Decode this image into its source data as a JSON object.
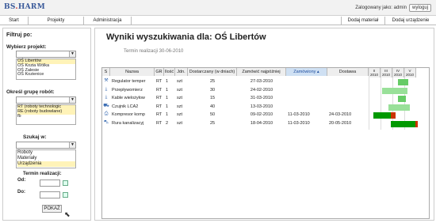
{
  "app": {
    "logo_main": "BS",
    "logo_dot": ".",
    "logo_rest": "HARM",
    "user_label": "Zalogowany jako: admin",
    "logout": "wyloguj"
  },
  "nav": {
    "items": [
      "Start",
      "Projekty",
      "Administracja"
    ],
    "right": [
      "Dodaj materiał",
      "Dodaj urządzenie"
    ]
  },
  "filters": {
    "heading": "Filtruj po:",
    "project_label": "Wybierz projekt:",
    "projects": [
      "OŚ Libertów",
      "OŚ Kozia Wólka",
      "OŚ Zalesie",
      "OŚ Kozienice"
    ],
    "robot_label": "Określ grupę robót:",
    "robot_groups": [
      "RT (roboty technologic",
      "RE (roboty budowlane)",
      "fb"
    ],
    "search_label": "Szukaj w:",
    "search_in": [
      "Roboty",
      "Materiały",
      "Urządzenia"
    ],
    "term_label": "Termin realizacji:",
    "from_label": "Od:",
    "to_label": "Do:",
    "show_button": "POKAŻ"
  },
  "main": {
    "title": "Wyniki wyszukiwania dla: OŚ Libertów",
    "subtitle": "Termin realizacji 30-06-2010",
    "columns": [
      "S",
      "Nazwa",
      "GR",
      "Ilość",
      "Jdn.",
      "Dostarczany (w dniach)",
      "Zamówić najpóźniej",
      "Zamówiony",
      "Dostawa"
    ],
    "gantt_headers": [
      {
        "mon": "II",
        "year": "2010"
      },
      {
        "mon": "III",
        "year": "2010"
      },
      {
        "mon": "IV",
        "year": "2010"
      },
      {
        "mon": "V",
        "year": "2010"
      }
    ],
    "rows": [
      {
        "icon": "wrench-icon",
        "glyph": "⚒",
        "name": "Regulator temper",
        "gr": "RT",
        "qty": "1",
        "unit": "szt",
        "days": "25",
        "order_by": "27-03-2010",
        "ordered": "",
        "delivery": "",
        "bars": [
          {
            "s": 0.62,
            "e": 0.84,
            "c": "#66cc66"
          }
        ]
      },
      {
        "icon": "download-icon",
        "glyph": "⤓",
        "name": "Przepływomierz",
        "gr": "RT",
        "qty": "1",
        "unit": "szt",
        "days": "30",
        "order_by": "24-02-2010",
        "ordered": "",
        "delivery": "",
        "bars": [
          {
            "s": 0.28,
            "e": 0.82,
            "c": "#99e099"
          }
        ]
      },
      {
        "icon": "download-icon",
        "glyph": "⤓",
        "name": "Kable wielożyłow",
        "gr": "RT",
        "qty": "1",
        "unit": "szt",
        "days": "15",
        "order_by": "31-03-2010",
        "ordered": "",
        "delivery": "",
        "bars": [
          {
            "s": 0.62,
            "e": 0.78,
            "c": "#66cc66"
          }
        ]
      },
      {
        "icon": "truck-icon",
        "glyph": "⛟",
        "name": "Czujnik LCA2",
        "gr": "RT",
        "qty": "1",
        "unit": "szt",
        "days": "40",
        "order_by": "13-03-2010",
        "ordered": "",
        "delivery": "",
        "bars": [
          {
            "s": 0.42,
            "e": 0.86,
            "c": "#99e099"
          }
        ]
      },
      {
        "icon": "print-icon",
        "glyph": "⎙",
        "name": "Kompresor komp",
        "gr": "RT",
        "qty": "1",
        "unit": "szt",
        "days": "50",
        "order_by": "09-02-2010",
        "ordered": "11-03-2010",
        "delivery": "24-03-2010",
        "bars": [
          {
            "s": 0.1,
            "e": 0.46,
            "c": "#009900"
          },
          {
            "s": 0.46,
            "e": 0.56,
            "c": "#cc3300"
          }
        ]
      },
      {
        "icon": "cart-icon",
        "glyph": "⛍",
        "name": "Rura kanalizacyj",
        "gr": "RT",
        "qty": "2",
        "unit": "szt",
        "days": "25",
        "order_by": "18-04-2010",
        "ordered": "11-03-2010",
        "delivery": "20-05-2010",
        "bars": [
          {
            "s": 0.46,
            "e": 0.98,
            "c": "#009900"
          },
          {
            "s": 0.98,
            "e": 1.04,
            "c": "#cc3300"
          }
        ]
      }
    ]
  }
}
